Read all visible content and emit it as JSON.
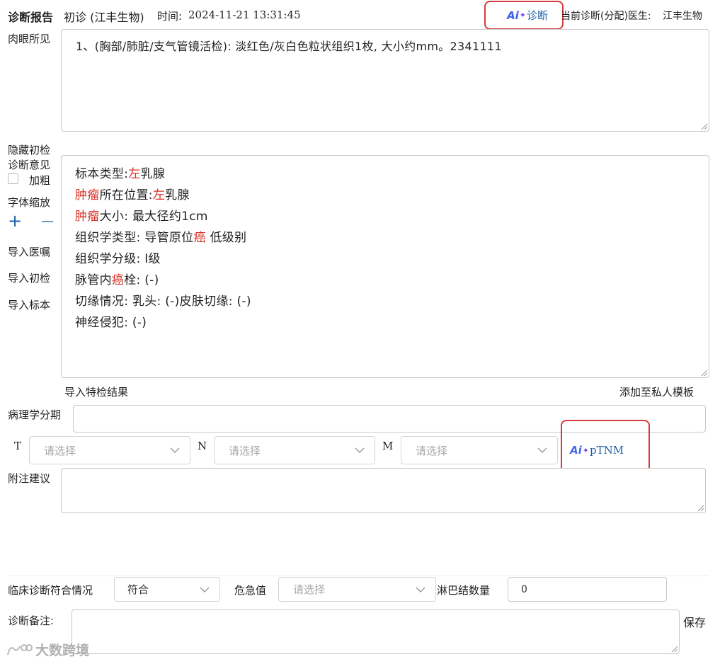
{
  "header": {
    "title": "诊断报告",
    "visit_type": "初诊 (江丰生物)",
    "time_label": "时间:",
    "time_value": "2024-11-21 13:31:45",
    "ai_diagnose_label": "诊断",
    "current_doctor_label": "当前诊断(分配)医生:",
    "current_doctor_name": "江丰生物"
  },
  "ai_logo": "Ai",
  "gross": {
    "label": "肉眼所见",
    "text": "1、(胸部/肺脏/支气管镜活检): 淡红色/灰白色粒状组织1枚, 大小约mm。2341111"
  },
  "side_menu": {
    "hide_initial": "隐藏初检",
    "opinion_label": "诊断意见",
    "bold_label": "加粗",
    "font_zoom": "字体缩放",
    "zoom_in": "+",
    "zoom_out": "—",
    "import_orders": "导入医嘱",
    "import_initial": "导入初检",
    "import_specimen": "导入标本"
  },
  "opinion": {
    "l1_a": "标本类型:",
    "l1_b": "左",
    "l1_c": "乳腺",
    "l2_a": "肿瘤",
    "l2_b": "所在位置:",
    "l2_c": "左",
    "l2_d": "乳腺",
    "l3_a": "肿瘤",
    "l3_b": "大小: 最大径约1cm",
    "l4_a": "组织学类型: 导管原位",
    "l4_b": "癌",
    "l4_c": " 低级别",
    "l5": "组织学分级: I级",
    "l6_a": "脉管内",
    "l6_b": "癌",
    "l6_c": "栓: (-)",
    "l7": "切缘情况: 乳头: (-)皮肤切缘: (-)",
    "l8": "神经侵犯: (-)"
  },
  "below_opinion": {
    "import_special": "导入特检结果",
    "add_private_template": "添加至私人模板"
  },
  "staging": {
    "label": "病理学分期",
    "t_label": "T",
    "n_label": "N",
    "m_label": "M",
    "t_placeholder": "请选择",
    "n_placeholder": "请选择",
    "m_placeholder": "请选择",
    "ai_ptnm_label": "pTNM"
  },
  "notes": {
    "label": "附注建议"
  },
  "clinical": {
    "match_label": "临床诊断符合情况",
    "match_value": "符合",
    "critical_label": "危急值",
    "critical_placeholder": "请选择",
    "lymph_label": "淋巴结数量",
    "lymph_value": "0"
  },
  "remark": {
    "label": "诊断备注:",
    "save_label": "保存"
  },
  "watermark": "大数跨境",
  "colors": {
    "link": "#1f5fa8",
    "red": "#d93025",
    "highlight": "#d63b3b"
  }
}
